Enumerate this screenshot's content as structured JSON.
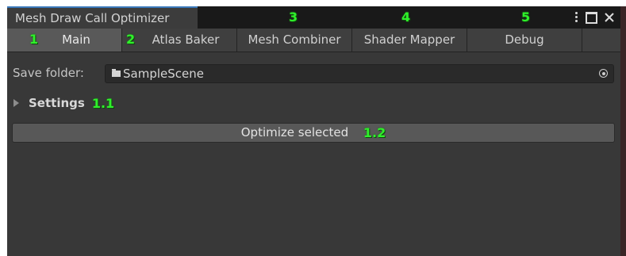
{
  "window": {
    "title": "Mesh Draw Call Optimizer"
  },
  "tabs": [
    {
      "label": "Main",
      "marker": "1",
      "active": true
    },
    {
      "label": "Atlas Baker",
      "marker": "2",
      "active": false
    },
    {
      "label": "Mesh Combiner",
      "marker": "3",
      "active": false
    },
    {
      "label": "Shader Mapper",
      "marker": "4",
      "active": false
    },
    {
      "label": "Debug",
      "marker": "5",
      "active": false
    }
  ],
  "main": {
    "save_folder_label": "Save folder:",
    "save_folder_value": "SampleScene",
    "settings_label": "Settings",
    "settings_marker": "1.1",
    "optimize_button_label": "Optimize selected",
    "optimize_marker": "1.2"
  },
  "icons": {
    "menu": "kebab-menu-icon",
    "maximize": "maximize-icon",
    "close": "close-icon",
    "folder": "folder-icon",
    "object_picker": "object-picker-icon",
    "foldout": "foldout-arrow-icon"
  },
  "colors": {
    "window_bg": "#383838",
    "title_accent": "#3a79bb",
    "active_tab": "#595959",
    "annotation_green": "#2ff02a"
  }
}
